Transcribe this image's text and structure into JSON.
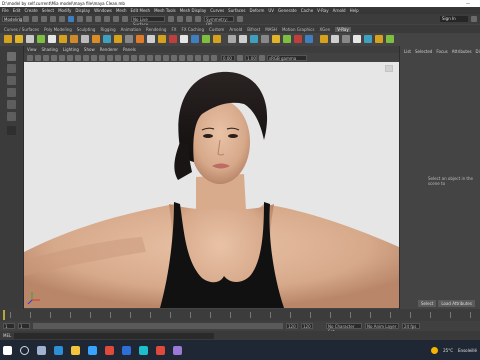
{
  "window": {
    "title": "D:\\model by self.current\\Mia model\\maya file\\maya Clean.mb",
    "dash": "—"
  },
  "menus": [
    "File",
    "Edit",
    "Create",
    "Select",
    "Modify",
    "Display",
    "Windows",
    "Mesh",
    "Edit Mesh",
    "Mesh Tools",
    "Mesh Display",
    "Curves",
    "Surfaces",
    "Deform",
    "UV",
    "Generate",
    "Cache",
    "V-Ray",
    "Arnold",
    "Help"
  ],
  "status": {
    "mode": "Modeling",
    "no_live_surface": "No Live Surface",
    "symmetry": "Symmetry: Off",
    "sign_in": "Sign In"
  },
  "shelf_tabs": [
    "Curves / Surfaces",
    "Poly Modeling",
    "Sculpting",
    "Rigging",
    "Animation",
    "Rendering",
    "FX",
    "FX Caching",
    "Custom",
    "Arnold",
    "Bifrost",
    "MASH",
    "Motion Graphics",
    "XGen",
    "V-Ray"
  ],
  "shelf_active": "V-Ray",
  "view_menu": [
    "View",
    "Shading",
    "Lighting",
    "Show",
    "Renderer",
    "Panels"
  ],
  "view_fields": {
    "exposure": "0.00",
    "gamma": "1.00",
    "colorspace": "sRGB gamma"
  },
  "attr_tabs": [
    "List",
    "Selected",
    "Focus",
    "Attributes",
    "Display"
  ],
  "attr_message": "Select an object in the scene to",
  "attr_buttons": [
    "Select",
    "Load Attributes"
  ],
  "timeline": {
    "start": "1",
    "end": "120",
    "frame": "1",
    "char_set": "No Character Set",
    "anim_layer": "No Anim Layer",
    "fps": "24 fps"
  },
  "cmd_label": "MEL",
  "weather": {
    "temp": "25°C",
    "desc": "Ensoleillé"
  },
  "colors": {
    "viewport_bg": "#e6e6e6",
    "accent": "#3f7fbf"
  },
  "taskbar_icons": [
    "windows-start-icon",
    "search-icon",
    "task-view-icon",
    "edge-icon",
    "file-explorer-icon",
    "store-icon",
    "chrome-icon",
    "photoshop-icon",
    "maya-icon",
    "media-icon",
    "app-icon"
  ],
  "shelf_icon_colors": [
    "#d6a21d",
    "#e0b429",
    "#c9c9c9",
    "#7fbf3f",
    "#e6e6e6",
    "#d6a21d",
    "#cf8a2a",
    "#bbbbbb",
    "#d98c28",
    "#3fa1bf",
    "#d6a21d",
    "#888",
    "#e07b2a",
    "#cfcfcf",
    "#d6a21d",
    "#bf3f3f",
    "#e6e6e6",
    "#3f7fbf",
    "#7fbf3f",
    "#d6a21d",
    "#aaaaaa",
    "#cfcfcf",
    "#3f9fbf",
    "#888888",
    "#e0b429",
    "#7fbf3f",
    "#bf3f3f",
    "#3f7fbf",
    "#d6a21d",
    "#cfcfcf",
    "#888",
    "#e6e6e6",
    "#3fa1bf",
    "#d6a21d",
    "#7fbf3f"
  ]
}
